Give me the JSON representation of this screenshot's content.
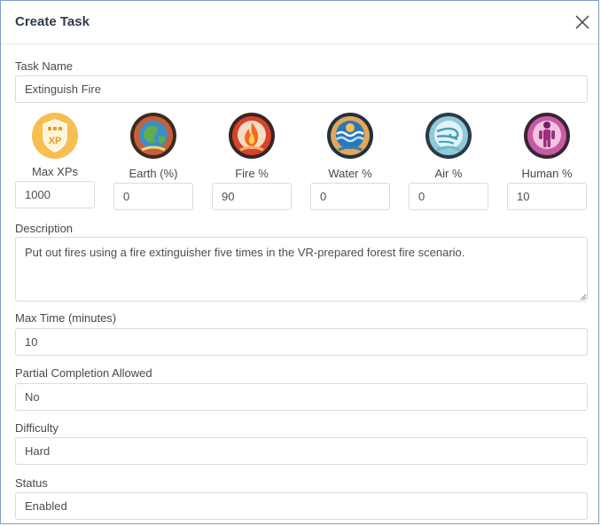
{
  "dialog": {
    "title": "Create Task",
    "close_icon": "close-icon"
  },
  "task_name": {
    "label": "Task Name",
    "value": "Extinguish Fire"
  },
  "attributes": [
    {
      "label": "Max XPs",
      "value": "1000",
      "icon": "xp-shield-icon",
      "color": "#f2b341"
    },
    {
      "label": "Earth (%)",
      "value": "0",
      "icon": "earth-globe-icon",
      "color": "#5a9a4a"
    },
    {
      "label": "Fire %",
      "value": "90",
      "icon": "fire-flame-icon",
      "color": "#e0552a"
    },
    {
      "label": "Water %",
      "value": "0",
      "icon": "water-wave-icon",
      "color": "#2c7fc0"
    },
    {
      "label": "Air %",
      "value": "0",
      "icon": "wind-swirl-icon",
      "color": "#6cb9c9"
    },
    {
      "label": "Human %",
      "value": "10",
      "icon": "human-figure-icon",
      "color": "#b64a96"
    }
  ],
  "description": {
    "label": "Description",
    "value": "Put out fires using a fire extinguisher five times in the VR-prepared forest fire scenario."
  },
  "max_time": {
    "label": "Max Time (minutes)",
    "value": "10"
  },
  "partial_completion": {
    "label": "Partial Completion Allowed",
    "value": "No"
  },
  "difficulty": {
    "label": "Difficulty",
    "value": "Hard"
  },
  "status": {
    "label": "Status",
    "value": "Enabled"
  }
}
